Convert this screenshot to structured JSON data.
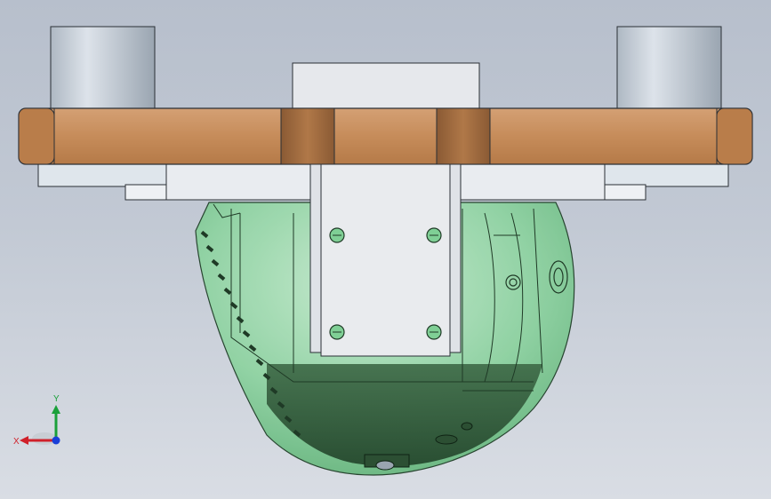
{
  "viewport": {
    "background_top": "#b7bfcc",
    "background_bottom": "#d9dde4"
  },
  "triad": {
    "x_label": "X",
    "y_label": "Y",
    "x_color": "#d0202a",
    "y_color": "#1aa03a",
    "z_color": "#1a3fd8",
    "icon": "coordinate-triad-icon"
  },
  "colors": {
    "plate": "#c58c5c",
    "plate_dark": "#9a6438",
    "steel": "#cdd3da",
    "bracket": "#e8eaee",
    "sphere": "#7fcf95",
    "sphere_dark": "#2e5a38"
  }
}
